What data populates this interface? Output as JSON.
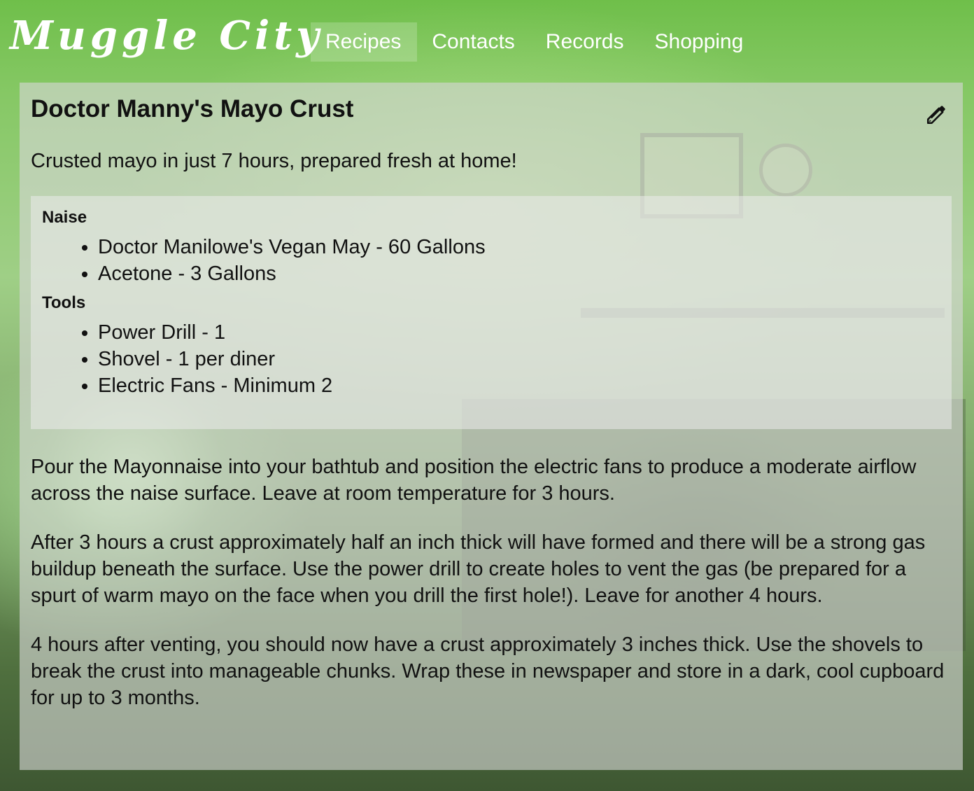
{
  "app": {
    "title": "Muggle City"
  },
  "nav": {
    "items": [
      {
        "label": "Recipes",
        "active": true
      },
      {
        "label": "Contacts",
        "active": false
      },
      {
        "label": "Records",
        "active": false
      },
      {
        "label": "Shopping",
        "active": false
      }
    ]
  },
  "recipe": {
    "title": "Doctor Manny's Mayo Crust",
    "description": "Crusted mayo in just 7 hours, prepared fresh at home!",
    "edit_icon": "pencil-icon",
    "groups": [
      {
        "name": "Naise",
        "items": [
          "Doctor Manilowe's Vegan May - 60 Gallons",
          "Acetone - 3 Gallons"
        ]
      },
      {
        "name": "Tools",
        "items": [
          "Power Drill - 1",
          "Shovel - 1 per diner",
          "Electric Fans - Minimum 2"
        ]
      }
    ],
    "steps": [
      "Pour the Mayonnaise into your bathtub and position the electric fans to produce a moderate airflow across the naise surface. Leave at room temperature for 3 hours.",
      "After 3 hours a crust approximately half an inch thick will have formed and there will be a strong gas buildup beneath the surface. Use the power drill to create holes to vent the gas (be prepared for a spurt of warm mayo on the face when you drill the first hole!). Leave for another 4 hours.",
      "4 hours after venting, you should now have a crust approximately 3 inches thick. Use the shovels to break the crust into manageable chunks. Wrap these in newspaper and store in a dark, cool cupboard for up to 3 months."
    ]
  },
  "colors": {
    "header_text": "#ffffff",
    "card_bg": "#d7d7d7",
    "text": "#111111"
  }
}
